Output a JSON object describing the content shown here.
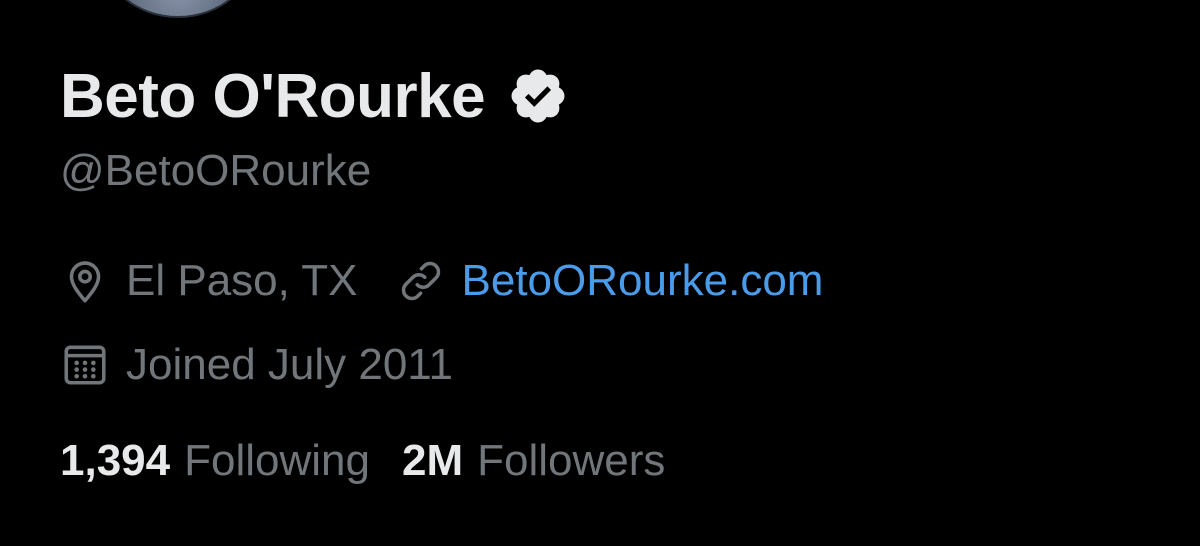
{
  "profile": {
    "display_name": "Beto O'Rourke",
    "handle": "@BetoORourke",
    "verified": true,
    "location": "El Paso, TX",
    "website": "BetoORourke.com",
    "joined": "Joined July 2011"
  },
  "stats": {
    "following_count": "1,394",
    "following_label": "Following",
    "followers_count": "2M",
    "followers_label": "Followers"
  },
  "icons": {
    "verified": "verified-badge-icon",
    "location": "location-pin-icon",
    "link": "link-icon",
    "calendar": "calendar-icon"
  },
  "colors": {
    "background": "#000000",
    "primary_text": "#e7e9ea",
    "secondary_text": "#71767b",
    "link": "#4a9be9"
  }
}
